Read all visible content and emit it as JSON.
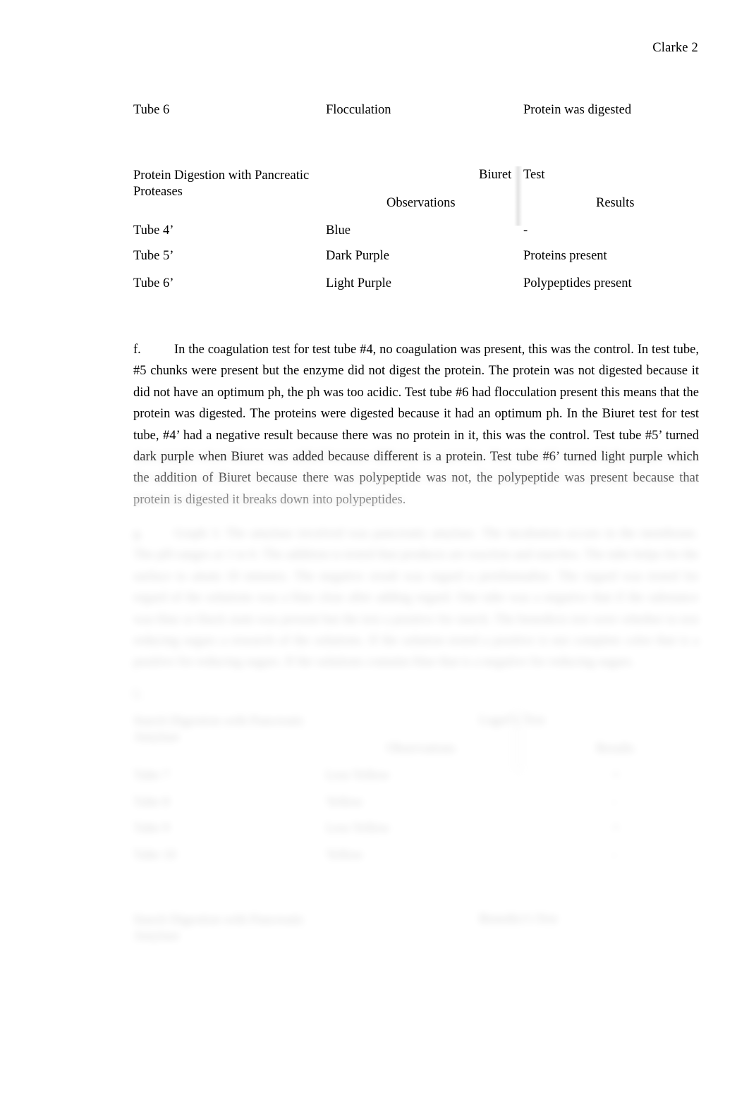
{
  "document": {
    "header": "Clarke 2"
  },
  "table_top_fragment": {
    "rows": [
      {
        "tube": "Tube 6",
        "observation": "Flocculation",
        "result": "Protein was digested"
      }
    ]
  },
  "table_biuret": {
    "title": "Protein Digestion with Pancreatic Proteases",
    "test_label_a": "Biuret",
    "test_label_b": "Test",
    "col_observations": "Observations",
    "col_results": "Results",
    "rows": [
      {
        "tube": "Tube 4’",
        "observation": "Blue",
        "result": "-"
      },
      {
        "tube": "Tube 5’",
        "observation": "Dark Purple",
        "result": "Proteins present"
      },
      {
        "tube": "Tube 6’",
        "observation": "Light Purple",
        "result": "Polypeptides present"
      }
    ]
  },
  "paragraph_f": {
    "marker": "f.",
    "text": "In the coagulation test for test tube #4, no coagulation was present, this was the control. In test tube, #5 chunks were present but the enzyme did not digest the protein. The protein was not digested because it did not have an optimum ph, the ph was too acidic. Test tube #6 had flocculation present this means that the protein was digested. The proteins were digested because it had an optimum ph. In the Biuret test for test tube, #4’ had a negative result because there was no protein in it, this was the control. Test tube #5’ turned dark purple when Biuret was added because different is a protein. Test tube #6’ turned light purple which the addition of Biuret because there was polypeptide was not, the polypeptide was present because that protein is digested it breaks down into polypeptides."
  },
  "paragraph_g": {
    "marker": "g.",
    "text": "Graph 3. The amylase involved was pancreatic amylase. The incubation occurs in the membrane. The pH ranges at 1 to 6. The addition is tested that products are reaction and starches. The tube helps for the surface to attain 10 minutes. The negative result was regard a pretilamadise. The regard was tested for regard of the solutions was a blue clear after adding regard. One tube was a negative that if the substance was blue or black stain was present but the test a positive for starch. The benedicts test were whether to test reducing sugars a research of the solutions. If the solution tested a positive is not complete color that is a positive for reducing sugars. If the solutions contains blue that is a negative for reducing sugars."
  },
  "paragraph_h": {
    "marker": "h."
  },
  "table_lugols": {
    "title": "Starch Digestion with Pancreatic Amylase",
    "test_label_a": "Lugol’s",
    "test_label_b": "Test",
    "col_observations": "Observations",
    "col_results": "Results",
    "rows": [
      {
        "tube": "Tube 7",
        "observation": "Less Yellow",
        "result": "+"
      },
      {
        "tube": "Tube 8",
        "observation": "Yellow",
        "result": "-"
      },
      {
        "tube": "Tube 9",
        "observation": "Less Yellow",
        "result": "+"
      },
      {
        "tube": "Tube 10",
        "observation": "Yellow",
        "result": "-"
      }
    ]
  },
  "table_benedicts": {
    "title": "Starch Digestion with Pancreatic Amylase",
    "test_label_a": "Benedict’s",
    "test_label_b": "Test"
  }
}
